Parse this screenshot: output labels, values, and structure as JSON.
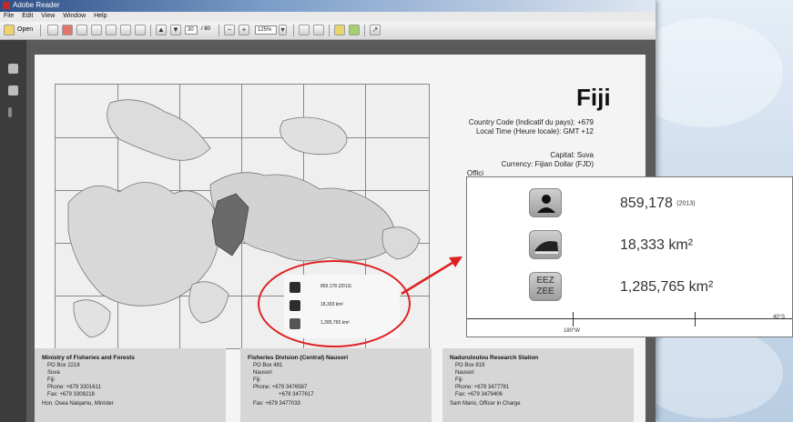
{
  "window": {
    "title": "Adobe Reader",
    "menu": [
      "File",
      "Edit",
      "View",
      "Window",
      "Help"
    ]
  },
  "toolbar": {
    "open_label": "Open",
    "page_current": "30",
    "page_total": "/ 80",
    "zoom": "125%"
  },
  "page": {
    "country": "Fiji",
    "country_code": "Country Code (Indicatif du pays): +679",
    "local_time": "Local Time (Heure locale): GMT +12",
    "capital": "Capital: Suva",
    "currency": "Currency: Fijian Dollar (FJD)",
    "official_prefix": "Offici"
  },
  "stats": {
    "population": "859,178",
    "population_year": "(2013)",
    "land_area": "18,333 km²",
    "eez_area": "1,285,765 km²",
    "eez_icon_text_1": "EEZ",
    "eez_icon_text_2": "ZEE"
  },
  "small_legend": {
    "population": "859,178 (2013)",
    "land_area": "18,333 km²",
    "eez_area": "1,285,765 km²"
  },
  "zoom_axis": {
    "label_left": "180°W",
    "label_right": "40°S"
  },
  "contacts": [
    {
      "title": "Ministry of Fisheries and Forests",
      "lines": [
        "PO Box 2218",
        "Suva",
        "Fiji",
        "Phone:  +679 3301611",
        "Fax:  +679 3308218",
        "Hon. Osea Naiqamu, Minister"
      ]
    },
    {
      "title": "Fisheries Division (Central) Nausori",
      "lines": [
        "PO Box 481",
        "Nausori",
        "Fiji",
        "Phone:  +679 3476587",
        "+679 3477617",
        "Fax:  +679 3477033"
      ]
    },
    {
      "title": "Naduruloulou Research Station",
      "lines": [
        "PO Box 819",
        "Nausori",
        "Fiji",
        "Phone:  +679 3477781",
        "Fax:  +679 3479406",
        "Sam Mario, Officer in Charge"
      ]
    }
  ],
  "colors": {
    "annotation_red": "#e02020",
    "window_frame": "#4a4a4a",
    "map_highlight": "#6a6a6a"
  }
}
